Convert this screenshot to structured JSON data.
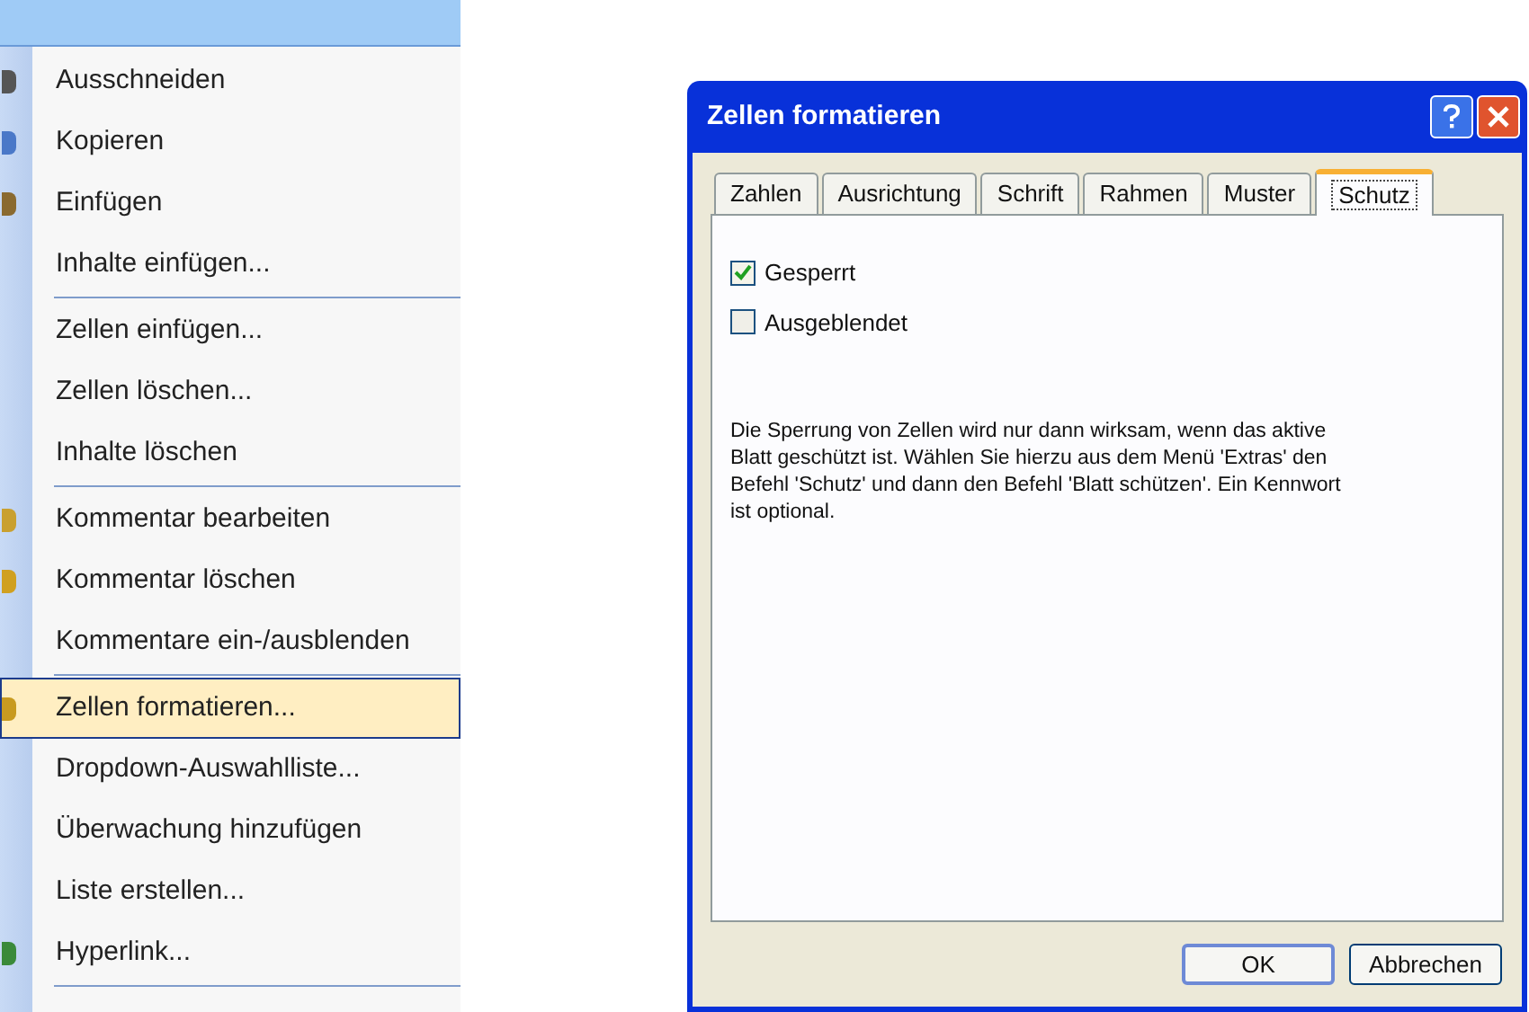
{
  "context_menu": {
    "items": [
      {
        "kind": "item",
        "label": "Ausschneiden",
        "highlighted": false
      },
      {
        "kind": "item",
        "label": "Kopieren",
        "highlighted": false
      },
      {
        "kind": "item",
        "label": "Einfügen",
        "highlighted": false
      },
      {
        "kind": "item",
        "label": "Inhalte einfügen...",
        "highlighted": false
      },
      {
        "kind": "separator"
      },
      {
        "kind": "item",
        "label": "Zellen einfügen...",
        "highlighted": false
      },
      {
        "kind": "item",
        "label": "Zellen löschen...",
        "highlighted": false
      },
      {
        "kind": "item",
        "label": "Inhalte löschen",
        "highlighted": false
      },
      {
        "kind": "separator"
      },
      {
        "kind": "item",
        "label": "Kommentar bearbeiten",
        "highlighted": false
      },
      {
        "kind": "item",
        "label": "Kommentar löschen",
        "highlighted": false
      },
      {
        "kind": "item",
        "label": "Kommentare ein-/ausblenden",
        "highlighted": false
      },
      {
        "kind": "separator"
      },
      {
        "kind": "item",
        "label": "Zellen formatieren...",
        "highlighted": true
      },
      {
        "kind": "item",
        "label": "Dropdown-Auswahlliste...",
        "highlighted": false
      },
      {
        "kind": "item",
        "label": "Überwachung hinzufügen",
        "highlighted": false
      },
      {
        "kind": "item",
        "label": "Liste erstellen...",
        "highlighted": false
      },
      {
        "kind": "item",
        "label": "Hyperlink...",
        "highlighted": false
      },
      {
        "kind": "separator"
      }
    ]
  },
  "dialog": {
    "title": "Zellen formatieren",
    "tabs": [
      {
        "label": "Zahlen",
        "selected": false
      },
      {
        "label": "Ausrichtung",
        "selected": false
      },
      {
        "label": "Schrift",
        "selected": false
      },
      {
        "label": "Rahmen",
        "selected": false
      },
      {
        "label": "Muster",
        "selected": false
      },
      {
        "label": "Schutz",
        "selected": true
      }
    ],
    "checkboxes": [
      {
        "label": "Gesperrt",
        "checked": true
      },
      {
        "label": "Ausgeblendet",
        "checked": false
      }
    ],
    "info_text": "Die Sperrung von Zellen wird nur dann wirksam, wenn das aktive Blatt geschützt ist. Wählen Sie hierzu aus dem Menü 'Extras' den Befehl 'Schutz' und dann den Befehl 'Blatt schützen'. Ein Kennwort ist optional.",
    "buttons": [
      {
        "label": "OK",
        "default": true
      },
      {
        "label": "Abbrechen",
        "default": false
      }
    ]
  }
}
